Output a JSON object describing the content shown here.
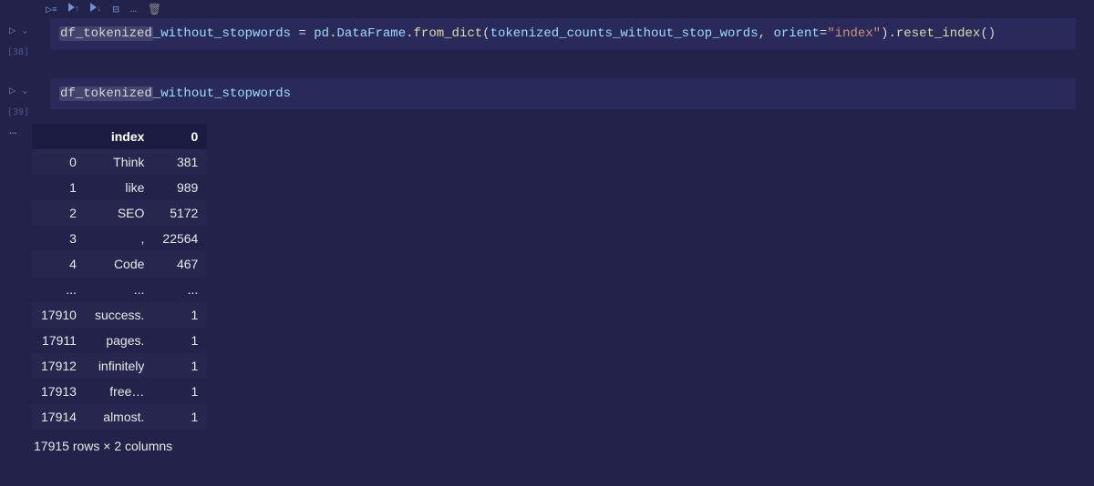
{
  "toolbar": {
    "icons": [
      "run-cell",
      "run-above",
      "run-below",
      "split-cell",
      "more",
      "delete-cell"
    ]
  },
  "cell1": {
    "exec_count": "[38]",
    "code": {
      "lhs_a": "df_tokenized",
      "lhs_b": "_without_stopwords",
      "assign": " = ",
      "seg1": "pd",
      "dot1": ".",
      "seg2": "DataFrame",
      "dot2": ".",
      "seg3": "from_dict",
      "open1": "(",
      "arg1": "tokenized_counts_without_stop_words",
      "comma1": ", ",
      "kw1": "orient",
      "eq1": "=",
      "str1": "\"index\"",
      "close1": ")",
      "dot3": ".",
      "seg4": "reset_index",
      "open2": "(",
      "close2": ")"
    }
  },
  "cell2": {
    "exec_count": "[39]",
    "code": {
      "lhs_a": "df_tokenized",
      "lhs_b": "_without_stopwords"
    }
  },
  "output": {
    "columns": [
      "",
      "index",
      "0"
    ],
    "rows": [
      {
        "idx": "0",
        "c1": "Think",
        "c2": "381"
      },
      {
        "idx": "1",
        "c1": "like",
        "c2": "989"
      },
      {
        "idx": "2",
        "c1": "SEO",
        "c2": "5172"
      },
      {
        "idx": "3",
        "c1": ",",
        "c2": "22564"
      },
      {
        "idx": "4",
        "c1": "Code",
        "c2": "467"
      },
      {
        "idx": "...",
        "c1": "...",
        "c2": "..."
      },
      {
        "idx": "17910",
        "c1": "success.",
        "c2": "1"
      },
      {
        "idx": "17911",
        "c1": "pages.",
        "c2": "1"
      },
      {
        "idx": "17912",
        "c1": "infinitely",
        "c2": "1"
      },
      {
        "idx": "17913",
        "c1": "free…",
        "c2": "1"
      },
      {
        "idx": "17914",
        "c1": "almost.",
        "c2": "1"
      }
    ],
    "caption": "17915 rows × 2 columns"
  }
}
